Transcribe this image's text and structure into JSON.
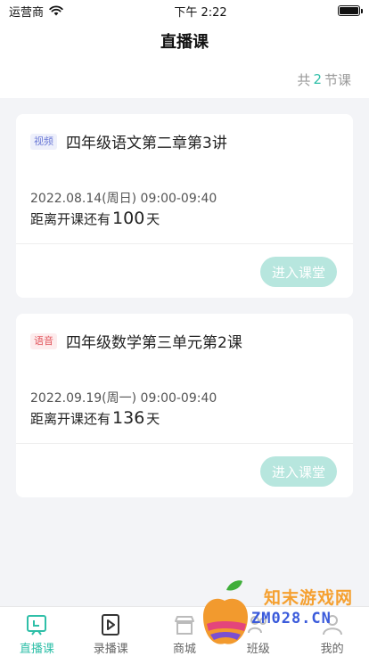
{
  "status_bar": {
    "carrier": "运营商",
    "time": "下午 2:22"
  },
  "nav": {
    "title": "直播课"
  },
  "summary": {
    "prefix": "共",
    "count": "2",
    "suffix": "节课"
  },
  "lessons": [
    {
      "tag": "视频",
      "title": "四年级语文第二章第3讲",
      "date": "2022.08.14(周日) 09:00-09:40",
      "countdown_prefix": "距离开课还有",
      "days": "100",
      "countdown_suffix": "天",
      "button": "进入课堂"
    },
    {
      "tag": "语音",
      "title": "四年级数学第三单元第2课",
      "date": "2022.09.19(周一) 09:00-09:40",
      "countdown_prefix": "距离开课还有",
      "days": "136",
      "countdown_suffix": "天",
      "button": "进入课堂"
    }
  ],
  "tabs": [
    {
      "label": "直播课",
      "icon": "live-icon",
      "active": true
    },
    {
      "label": "录播课",
      "icon": "video-icon",
      "active": false
    },
    {
      "label": "商城",
      "icon": "shop-icon",
      "active": false
    },
    {
      "label": "班级",
      "icon": "class-icon",
      "active": false
    },
    {
      "label": "我的",
      "icon": "user-icon",
      "active": false
    }
  ],
  "watermark": {
    "text": "知末游戏网",
    "url": "ZM028.CN"
  },
  "colors": {
    "accent": "#2fbfa8",
    "button_disabled": "#b7e6de",
    "tag_video": "#6b79d6",
    "tag_audio": "#e2575e"
  }
}
